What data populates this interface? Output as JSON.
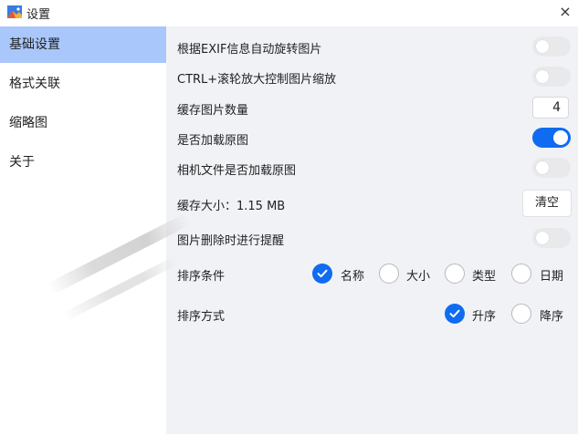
{
  "window": {
    "title": "设置",
    "close_icon": "×"
  },
  "sidebar": {
    "items": [
      {
        "label": "基础设置",
        "active": true
      },
      {
        "label": "格式关联",
        "active": false
      },
      {
        "label": "缩略图",
        "active": false
      },
      {
        "label": "关于",
        "active": false
      }
    ]
  },
  "settings": {
    "auto_rotate_exif": {
      "label": "根据EXIF信息自动旋转图片",
      "enabled": false
    },
    "ctrl_wheel_zoom": {
      "label": "CTRL+滚轮放大控制图片缩放",
      "enabled": false
    },
    "cache_count": {
      "label": "缓存图片数量",
      "value": "4"
    },
    "load_original": {
      "label": "是否加载原图",
      "enabled": true
    },
    "camera_load_original": {
      "label": "相机文件是否加载原图",
      "enabled": false
    },
    "cache_size": {
      "label": "缓存大小：1.15 MB",
      "clear_label": "清空"
    },
    "delete_prompt": {
      "label": "图片删除时进行提醒",
      "enabled": false
    },
    "sort_condition": {
      "label": "排序条件",
      "options": [
        "名称",
        "大小",
        "类型",
        "日期"
      ],
      "selected": "名称"
    },
    "sort_order": {
      "label": "排序方式",
      "options": [
        "升序",
        "降序"
      ],
      "selected": "升序"
    }
  },
  "colors": {
    "accent": "#0f6cf0",
    "sidebar_active": "#a9c7fb",
    "content_bg": "#f1f2f6"
  }
}
